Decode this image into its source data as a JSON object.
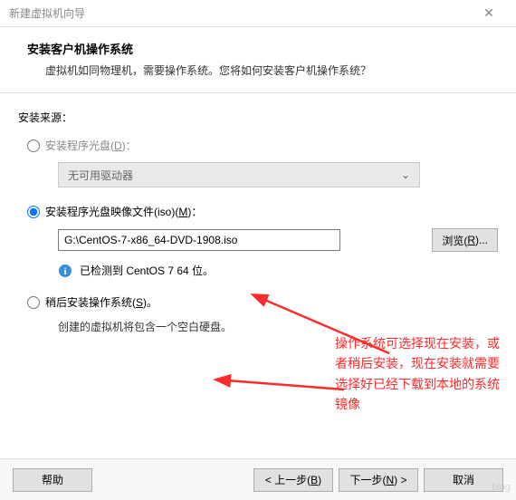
{
  "window": {
    "title": "新建虚拟机向导"
  },
  "header": {
    "title": "安装客户机操作系统",
    "subtitle": "虚拟机如同物理机，需要操作系统。您将如何安装客户机操作系统？"
  },
  "source_label": "安装来源：",
  "options": {
    "disc": {
      "label": "安装程序光盘(",
      "mnemonic": "D",
      "label_suffix": ")：",
      "combo_text": "无可用驱动器"
    },
    "iso": {
      "label": "安装程序光盘映像文件(iso)(",
      "mnemonic": "M",
      "label_suffix": ")：",
      "path": "G:\\CentOS-7-x86_64-DVD-1908.iso",
      "browse_prefix": "浏览(",
      "browse_mnemonic": "R",
      "browse_suffix": ")...",
      "detected": "已检测到 CentOS 7 64 位。"
    },
    "later": {
      "label": "稍后安装操作系统(",
      "mnemonic": "S",
      "label_suffix": ")。",
      "hint": "创建的虚拟机将包含一个空白硬盘。"
    }
  },
  "footer": {
    "help": "帮助",
    "back_prefix": "< 上一步(",
    "back_mnemonic": "B",
    "back_suffix": ")",
    "next_prefix": "下一步(",
    "next_mnemonic": "N",
    "next_suffix": ") >",
    "cancel": "取消"
  },
  "annotation": "操作系统可选择现在安装，或者稍后安装，现在安装就需要选择好已经下载到本地的系统镜像",
  "watermark": "blog"
}
